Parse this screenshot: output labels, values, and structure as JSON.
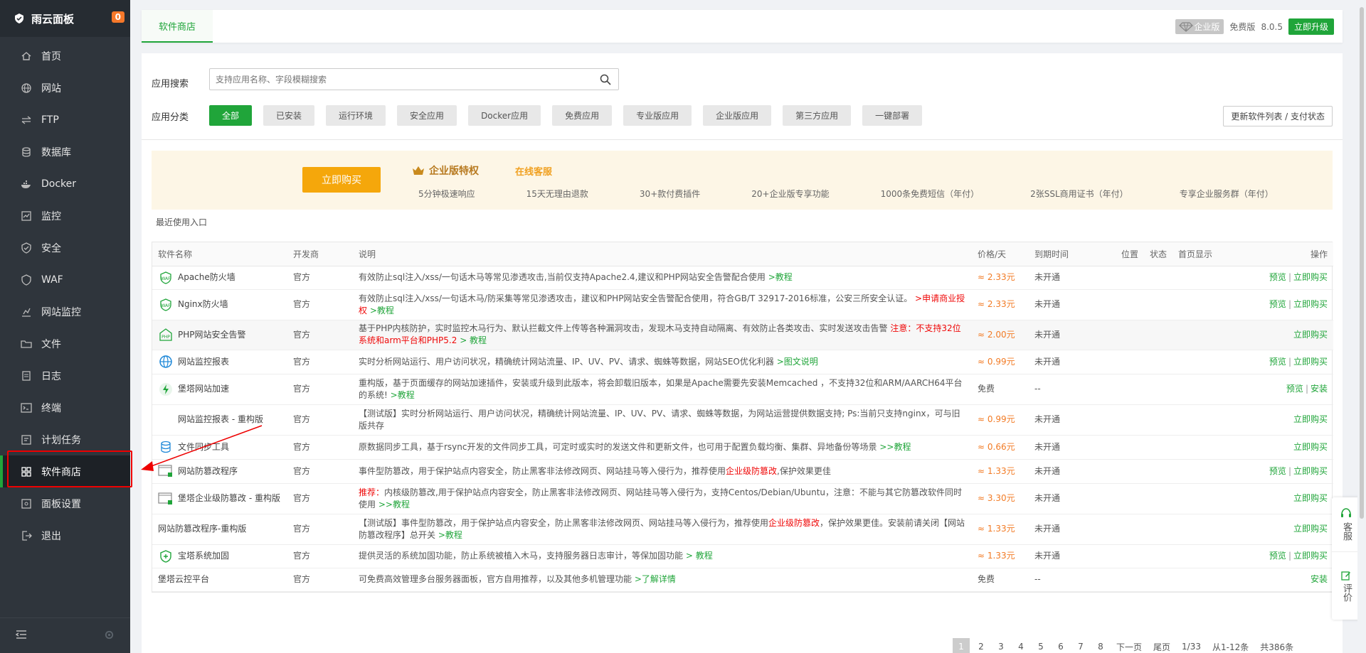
{
  "sidebar": {
    "brand": "雨云面板",
    "badge": "0",
    "items": [
      {
        "label": "首页",
        "icon": "home-icon"
      },
      {
        "label": "网站",
        "icon": "globe-icon"
      },
      {
        "label": "FTP",
        "icon": "ftp-icon"
      },
      {
        "label": "数据库",
        "icon": "database-icon"
      },
      {
        "label": "Docker",
        "icon": "docker-icon"
      },
      {
        "label": "监控",
        "icon": "monitor-icon"
      },
      {
        "label": "安全",
        "icon": "shield-icon"
      },
      {
        "label": "WAF",
        "icon": "waf-icon"
      },
      {
        "label": "网站监控",
        "icon": "chart-icon"
      },
      {
        "label": "文件",
        "icon": "folder-icon"
      },
      {
        "label": "日志",
        "icon": "log-icon"
      },
      {
        "label": "终端",
        "icon": "terminal-icon"
      },
      {
        "label": "计划任务",
        "icon": "clock-icon"
      },
      {
        "label": "软件商店",
        "icon": "grid-icon"
      },
      {
        "label": "面板设置",
        "icon": "settings-icon"
      },
      {
        "label": "退出",
        "icon": "logout-icon"
      }
    ]
  },
  "topbar": {
    "tab": "软件商店",
    "enterprise": "企业版",
    "free": "免费版",
    "version": "8.0.5",
    "upgrade": "立即升级"
  },
  "search": {
    "label": "应用搜索",
    "placeholder": "支持应用名称、字段模糊搜索"
  },
  "categories": {
    "label": "应用分类",
    "items": [
      "全部",
      "已安装",
      "运行环境",
      "安全应用",
      "Docker应用",
      "免费应用",
      "专业版应用",
      "企业版应用",
      "第三方应用",
      "一键部署"
    ],
    "refresh": "更新软件列表 / 支付状态"
  },
  "promo": {
    "buy": "立即购买",
    "title": "企业版特权",
    "service": "在线客服",
    "features": [
      "5分钟极速响应",
      "15天无理由退款",
      "30+款付费插件",
      "20+企业版专享功能",
      "1000条免费短信（年付）",
      "2张SSL商用证书（年付）",
      "专享企业服务群（年付）"
    ]
  },
  "recent": "最近使用入口",
  "table": {
    "headers": [
      "软件名称",
      "开发商",
      "说明",
      "价格/天",
      "到期时间",
      "位置",
      "状态",
      "首页显示",
      "操作"
    ],
    "rows": [
      {
        "name": "Apache防火墙",
        "dev": "官方",
        "desc": "有效防止sql注入/xss/一句话木马等常见渗透攻击,当前仅支持Apache2.4,建议和PHP网站安全告警配合使用",
        "extra": ">教程",
        "warn": "",
        "price": "≈ 2.33元",
        "expire": "未开通",
        "op1": "预览",
        "op2": "立即购买"
      },
      {
        "name": "Nginx防火墙",
        "dev": "官方",
        "desc": "有效防止sql注入/xss/一句话木马/防采集等常见渗透攻击，建议和PHP网站安全告警配合使用，符合GB/T 32917-2016标准，公安三所安全认证。",
        "extra": ">教程",
        "warn": ">申请商业授权",
        "price": "≈ 2.33元",
        "expire": "未开通",
        "op1": "预览",
        "op2": "立即购买"
      },
      {
        "name": "PHP网站安全告警",
        "dev": "官方",
        "desc": "基于PHP内核防护，实时监控木马行为、默认拦截文件上传等各种漏洞攻击，发现木马支持自动隔离、有效防止各类攻击、实时发送攻击告警",
        "extra": "> 教程",
        "warn": "注意：不支持32位系统和arm平台和PHP5.2",
        "price": "≈ 2.00元",
        "expire": "未开通",
        "op1": "",
        "op2": "立即购买"
      },
      {
        "name": "网站监控报表",
        "dev": "官方",
        "desc": "实时分析网站运行、用户访问状况，精确统计网站流量、IP、UV、PV、请求、蜘蛛等数据，网站SEO优化利器",
        "extra": ">图文说明",
        "warn": "",
        "price": "≈ 0.99元",
        "expire": "未开通",
        "op1": "预览",
        "op2": "立即购买"
      },
      {
        "name": "堡塔网站加速",
        "dev": "官方",
        "desc": "重构版，基于页面缓存的网站加速插件，安装或升级到此版本，将会卸载旧版本，如果是Apache需要先安装Memcached ，不支持32位和ARM/AARCH64平台的系统!",
        "extra": ">教程",
        "warn": "",
        "price": "免费",
        "expire": "--",
        "op1": "预览",
        "op2": "安装"
      },
      {
        "name": "网站监控报表 - 重构版",
        "dev": "官方",
        "desc": "【测试版】实时分析网站运行、用户访问状况，精确统计网站流量、IP、UV、PV、请求、蜘蛛等数据，为网站运营提供数据支持; Ps:当前只支持nginx，可与旧版共存",
        "extra": "",
        "warn": "",
        "price": "≈ 0.99元",
        "expire": "未开通",
        "op1": "",
        "op2": "立即购买"
      },
      {
        "name": "文件同步工具",
        "dev": "官方",
        "desc": "原数据同步工具，基于rsync开发的文件同步工具，可定时或实时的发送文件和更新文件，也可用于配置负载均衡、集群、异地备份等场景",
        "extra": ">>教程",
        "warn": "",
        "price": "≈ 0.66元",
        "expire": "未开通",
        "op1": "",
        "op2": "立即购买"
      },
      {
        "name": "网站防篡改程序",
        "dev": "官方",
        "desc": "事件型防篡改，用于保护站点内容安全，防止黑客非法修改网页、网站挂马等入侵行为，推荐使用",
        "extra": "",
        "warn": "企业级防篡改",
        "tail": ",保护效果更佳",
        "price": "≈ 1.33元",
        "expire": "未开通",
        "op1": "预览",
        "op2": "立即购买"
      },
      {
        "name": "堡塔企业级防篡改 - 重构版",
        "dev": "官方",
        "pre": "推荐：",
        "desc": "内核级防篡改,用于保护站点内容安全，防止黑客非法修改网页、网站挂马等入侵行为，支持Centos/Debian/Ubuntu，注意：不能与其它防篡改软件同时使用",
        "extra": ">>教程",
        "warn": "",
        "price": "≈ 3.30元",
        "expire": "未开通",
        "op1": "",
        "op2": "立即购买"
      },
      {
        "name": "网站防篡改程序-重构版",
        "dev": "官方",
        "desc": "【测试版】事件型防篡改，用于保护站点内容安全，防止黑客非法修改网页、网站挂马等入侵行为，推荐使用",
        "extra": ">教程",
        "warn": "企业级防篡改",
        "tail": "，保护效果更佳。安装前请关闭【网站防篡改程序】总开关",
        "price": "≈ 1.33元",
        "expire": "未开通",
        "op1": "",
        "op2": "立即购买"
      },
      {
        "name": "宝塔系统加固",
        "dev": "官方",
        "desc": "提供灵活的系统加固功能，防止系统被植入木马，支持服务器日志审计，等保加固功能",
        "extra": "> 教程",
        "warn": "",
        "price": "≈ 1.33元",
        "expire": "未开通",
        "op1": "预览",
        "op2": "立即购买"
      },
      {
        "name": "堡塔云控平台",
        "dev": "官方",
        "desc": "可免费高效管理多台服务器面板，官方自用推荐，以及其他多机管理功能",
        "extra": ">了解详情",
        "warn": "",
        "price": "免费",
        "expire": "--",
        "op1": "",
        "op2": "安装"
      }
    ]
  },
  "pager": {
    "pages": [
      "1",
      "2",
      "3",
      "4",
      "5",
      "6",
      "7",
      "8"
    ],
    "next": "下一页",
    "last": "尾页",
    "count": "1/33",
    "range": "从1-12条",
    "total": "共386条"
  },
  "float": {
    "service": "客服",
    "review": "评价"
  }
}
